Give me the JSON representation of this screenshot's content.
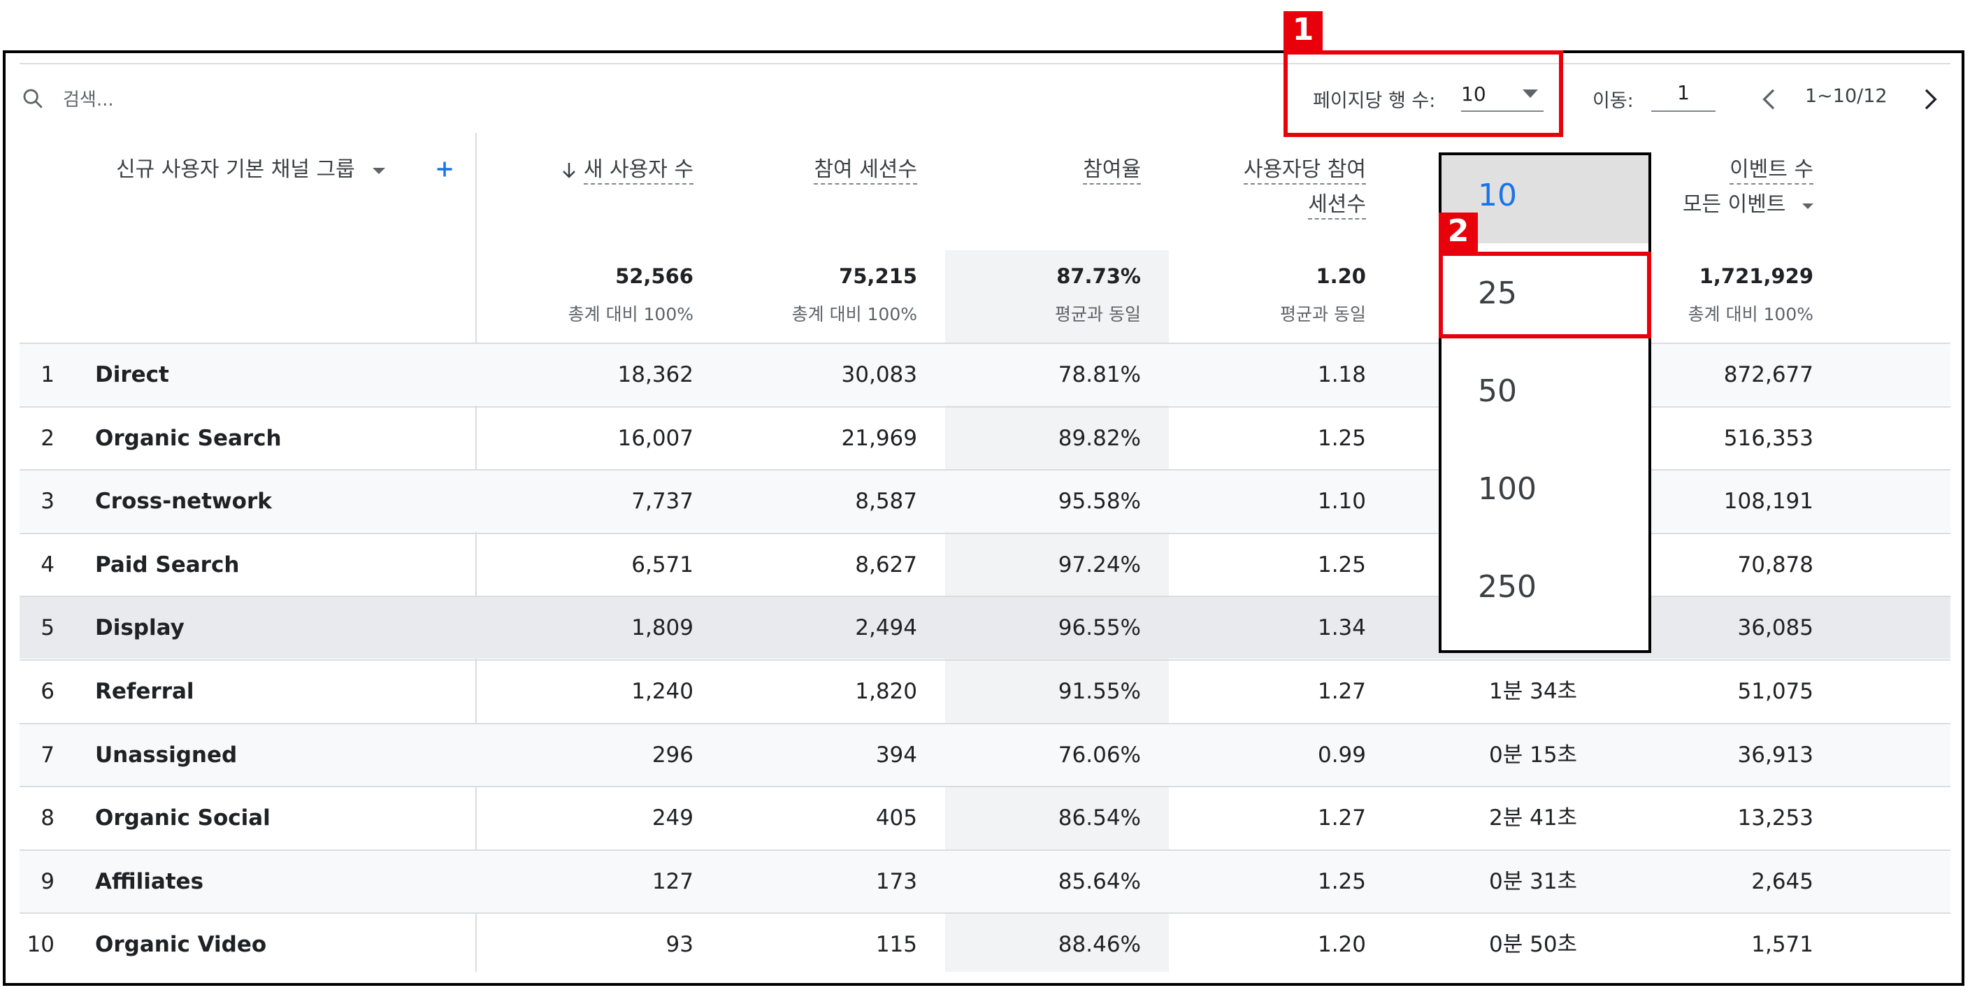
{
  "toolbar": {
    "search_placeholder": "검색...",
    "rows_per_page_label": "페이지당 행 수:",
    "rows_per_page_value": "10",
    "goto_label": "이동:",
    "goto_value": "1",
    "range_text": "1~10/12"
  },
  "annotations": [
    "1",
    "2"
  ],
  "table": {
    "dimension_header": "신규 사용자 기본 채널 그룹",
    "columns": [
      {
        "label": "새 사용자 수",
        "sort": "desc"
      },
      {
        "label": "참여 세션수"
      },
      {
        "label": "참여율"
      },
      {
        "label_line1": "사용자당 참여",
        "label_line2": "세션수"
      },
      {
        "label_line1": "이벤트 수",
        "label_line2": "모든 이벤트"
      }
    ],
    "totals": [
      {
        "value": "52,566",
        "sub": "총계 대비 100%"
      },
      {
        "value": "75,215",
        "sub": "총계 대비 100%"
      },
      {
        "value": "87.73%",
        "sub": "평균과 동일"
      },
      {
        "value": "1.20",
        "sub": "평균과 동일"
      },
      {
        "value": "1,721,929",
        "sub": "총계 대비 100%"
      }
    ],
    "rows": [
      {
        "idx": "1",
        "name": "Direct",
        "new_users": "18,362",
        "sessions": "30,083",
        "rate": "78.81%",
        "per_user": "1.18",
        "time": "",
        "events": "872,677"
      },
      {
        "idx": "2",
        "name": "Organic Search",
        "new_users": "16,007",
        "sessions": "21,969",
        "rate": "89.82%",
        "per_user": "1.25",
        "time": "",
        "events": "516,353"
      },
      {
        "idx": "3",
        "name": "Cross-network",
        "new_users": "7,737",
        "sessions": "8,587",
        "rate": "95.58%",
        "per_user": "1.10",
        "time": "",
        "events": "108,191"
      },
      {
        "idx": "4",
        "name": "Paid Search",
        "new_users": "6,571",
        "sessions": "8,627",
        "rate": "97.24%",
        "per_user": "1.25",
        "time": "",
        "events": "70,878"
      },
      {
        "idx": "5",
        "name": "Display",
        "new_users": "1,809",
        "sessions": "2,494",
        "rate": "96.55%",
        "per_user": "1.34",
        "time": "",
        "events": "36,085"
      },
      {
        "idx": "6",
        "name": "Referral",
        "new_users": "1,240",
        "sessions": "1,820",
        "rate": "91.55%",
        "per_user": "1.27",
        "time": "1분 34초",
        "events": "51,075"
      },
      {
        "idx": "7",
        "name": "Unassigned",
        "new_users": "296",
        "sessions": "394",
        "rate": "76.06%",
        "per_user": "0.99",
        "time": "0분 15초",
        "events": "36,913"
      },
      {
        "idx": "8",
        "name": "Organic Social",
        "new_users": "249",
        "sessions": "405",
        "rate": "86.54%",
        "per_user": "1.27",
        "time": "2분 41초",
        "events": "13,253"
      },
      {
        "idx": "9",
        "name": "Affiliates",
        "new_users": "127",
        "sessions": "173",
        "rate": "85.64%",
        "per_user": "1.25",
        "time": "0분 31초",
        "events": "2,645"
      },
      {
        "idx": "10",
        "name": "Organic Video",
        "new_users": "93",
        "sessions": "115",
        "rate": "88.46%",
        "per_user": "1.20",
        "time": "0분 50초",
        "events": "1,571"
      }
    ]
  },
  "dropdown": {
    "options": [
      "10",
      "25",
      "50",
      "100",
      "250"
    ],
    "selected": "10"
  },
  "colors": {
    "accent": "#1a73e8",
    "annotation": "#e8000b"
  }
}
